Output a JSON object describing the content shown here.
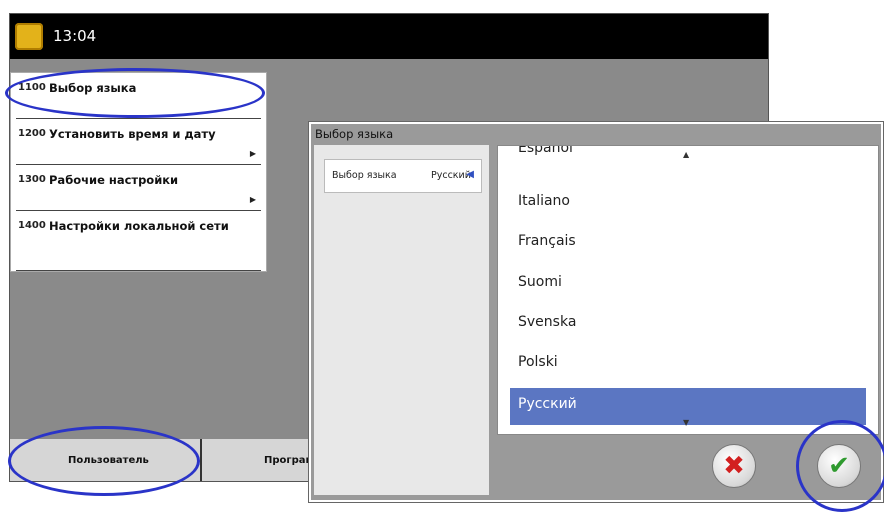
{
  "status_bar": {
    "time": "13:04",
    "logo_icon": "app-logo-icon"
  },
  "menu": {
    "items": [
      {
        "code": "1100",
        "label": "Выбор языка",
        "has_arrow": false
      },
      {
        "code": "1200",
        "label": "Установить время и дату",
        "has_arrow": true
      },
      {
        "code": "1300",
        "label": "Рабочие настройки",
        "has_arrow": true
      },
      {
        "code": "1400",
        "label": "Настройки локальной сети",
        "has_arrow": false
      }
    ],
    "arrow_glyph": "▶"
  },
  "tabs": [
    {
      "label": "Пользователь"
    },
    {
      "label": "Програм"
    }
  ],
  "dialog": {
    "title": "Выбор языка",
    "field_label": "Выбор языка",
    "field_value": "Русский",
    "field_caret": "◀",
    "languages": [
      "Español",
      "Italiano",
      "Français",
      "Suomi",
      "Svenska",
      "Polski",
      "Русский"
    ],
    "selected_language": "Русский",
    "scroll_up_glyph": "▲",
    "scroll_down_glyph": "▼",
    "cancel_glyph": "✖",
    "ok_glyph": "✔"
  },
  "colors": {
    "selection": "#5b76c2",
    "annotation": "#2a34c8",
    "cancel": "#d22020",
    "ok": "#2f9a2f"
  }
}
